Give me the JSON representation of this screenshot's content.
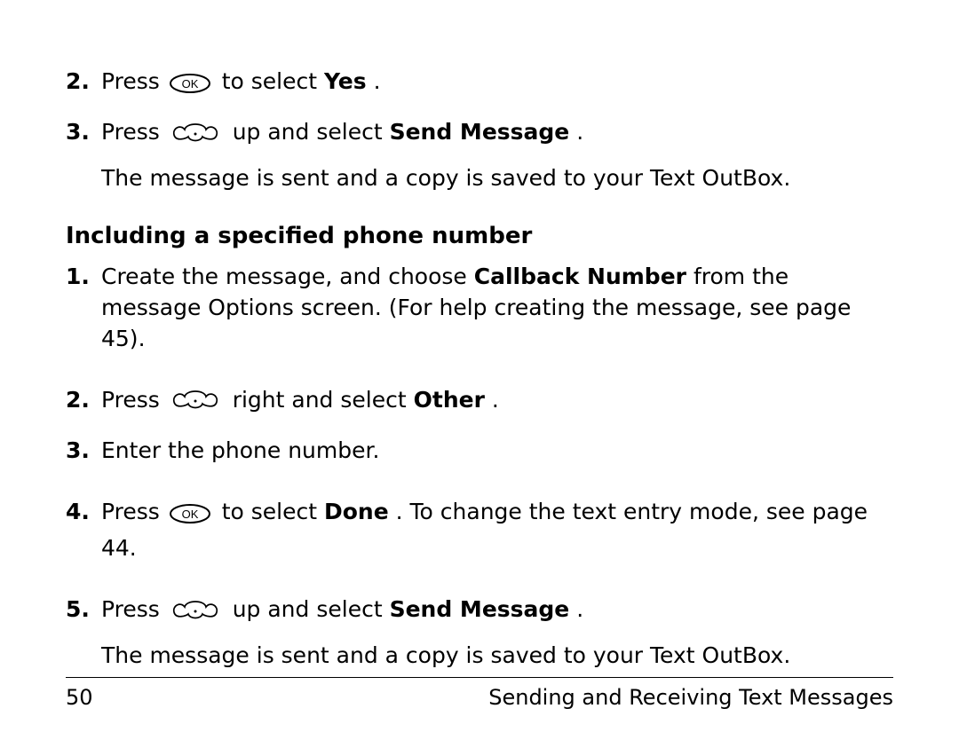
{
  "listA": {
    "start": 2,
    "items": [
      {
        "num": "2.",
        "parts": [
          "Press ",
          " to select ",
          "Yes",
          "."
        ],
        "icon": "ok"
      },
      {
        "num": "3.",
        "parts": [
          "Press ",
          " up and select ",
          "Send Message",
          "."
        ],
        "icon": "nav",
        "after": "The message is sent and a copy is saved to your Text OutBox."
      }
    ]
  },
  "heading": "Including a specified phone number",
  "listB": {
    "items": [
      {
        "num": "1.",
        "text_before": "Create the message, and choose ",
        "bold": "Callback Number",
        "text_after": " from the message Options screen. (For help creating the message, see page 45)."
      },
      {
        "num": "2.",
        "parts": [
          "Press ",
          " right and select ",
          "Other",
          "."
        ],
        "icon": "nav"
      },
      {
        "num": "3.",
        "plain": "Enter the phone number."
      },
      {
        "num": "4.",
        "parts": [
          "Press ",
          " to select ",
          "Done",
          ". To change the text entry mode, see page 44."
        ],
        "icon": "ok"
      },
      {
        "num": "5.",
        "parts": [
          "Press ",
          " up and select ",
          "Send Message",
          "."
        ],
        "icon": "nav",
        "after": "The message is sent and a copy is saved to your Text OutBox."
      }
    ]
  },
  "footer": {
    "page_num": "50",
    "section": "Sending and Receiving Text Messages"
  }
}
